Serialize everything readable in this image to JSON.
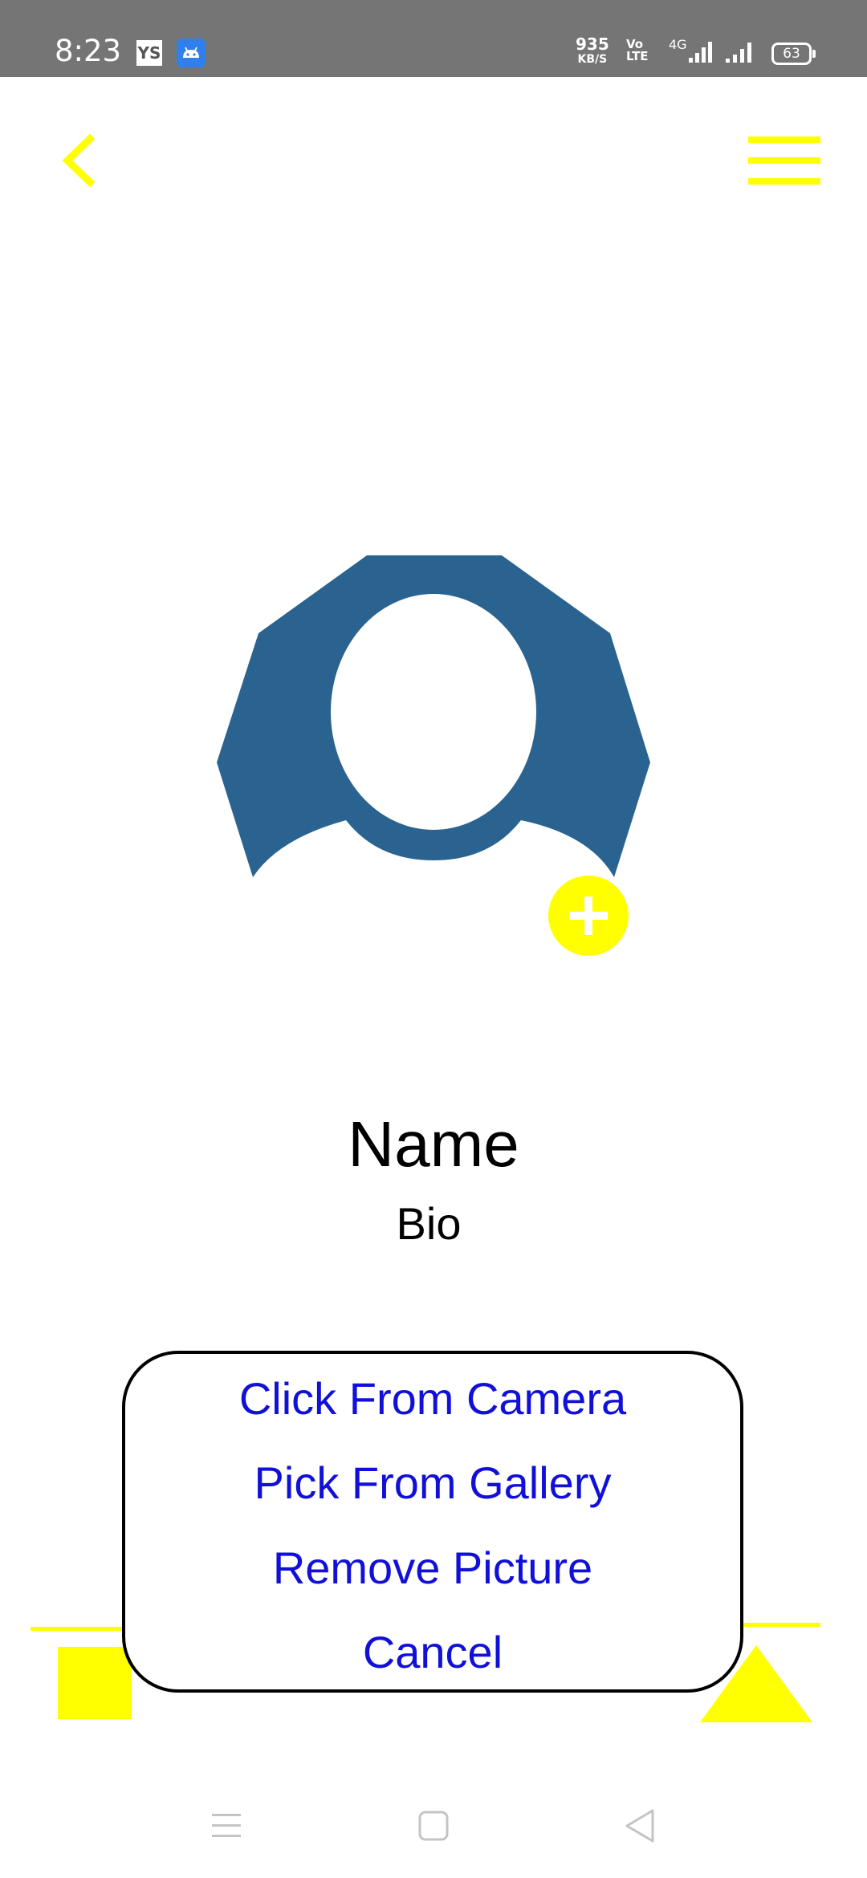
{
  "status_bar": {
    "time": "8:23",
    "ys_badge": "YS",
    "net_speed_value": "935",
    "net_speed_unit": "KB/S",
    "volte_line1": "Vo",
    "volte_line2": "LTE",
    "network_type": "4G",
    "battery": "63"
  },
  "toolbar": {
    "back_icon": "chevron-left-icon",
    "menu_icon": "hamburger-menu-icon"
  },
  "profile": {
    "name": "Name",
    "bio": "Bio",
    "avatar_icon": "default-user-avatar",
    "add_photo_icon": "plus-icon"
  },
  "photo_dialog": {
    "options": [
      "Click From Camera",
      "Pick From Gallery",
      "Remove Picture",
      "Cancel"
    ]
  },
  "colors": {
    "accent": "#ffff00",
    "avatar": "#2b6390",
    "dialog_text": "#1010d8",
    "status_bar": "#757575"
  },
  "nav_bar": {
    "icons": [
      "recent-apps-icon",
      "home-icon",
      "back-icon"
    ]
  }
}
